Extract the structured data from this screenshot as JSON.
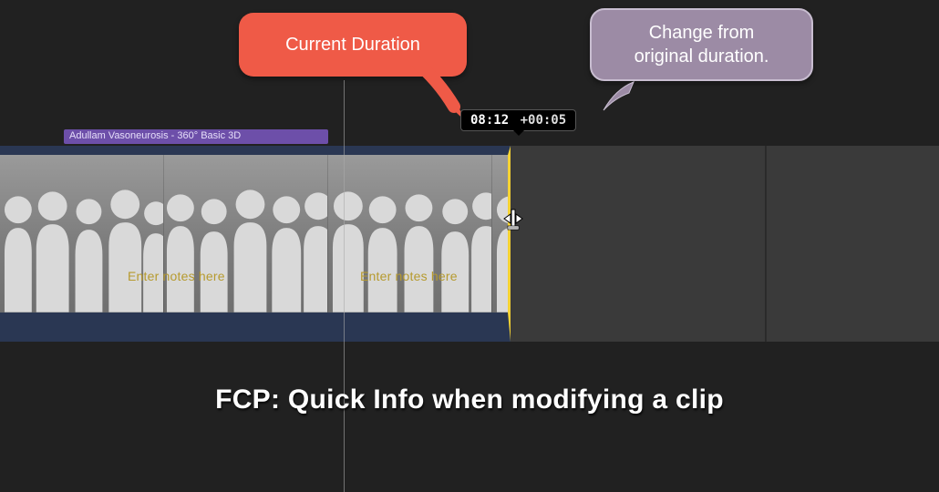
{
  "callouts": {
    "current_duration": "Current Duration",
    "change_from_original": "Change from\noriginal duration."
  },
  "tooltip": {
    "current": "08:12",
    "delta": "+00:05"
  },
  "clip_title": "Adullam Vasoneurosis  - 360° Basic 3D",
  "notes_placeholder": "Enter notes here",
  "caption": "FCP: Quick Info when modifying a clip"
}
